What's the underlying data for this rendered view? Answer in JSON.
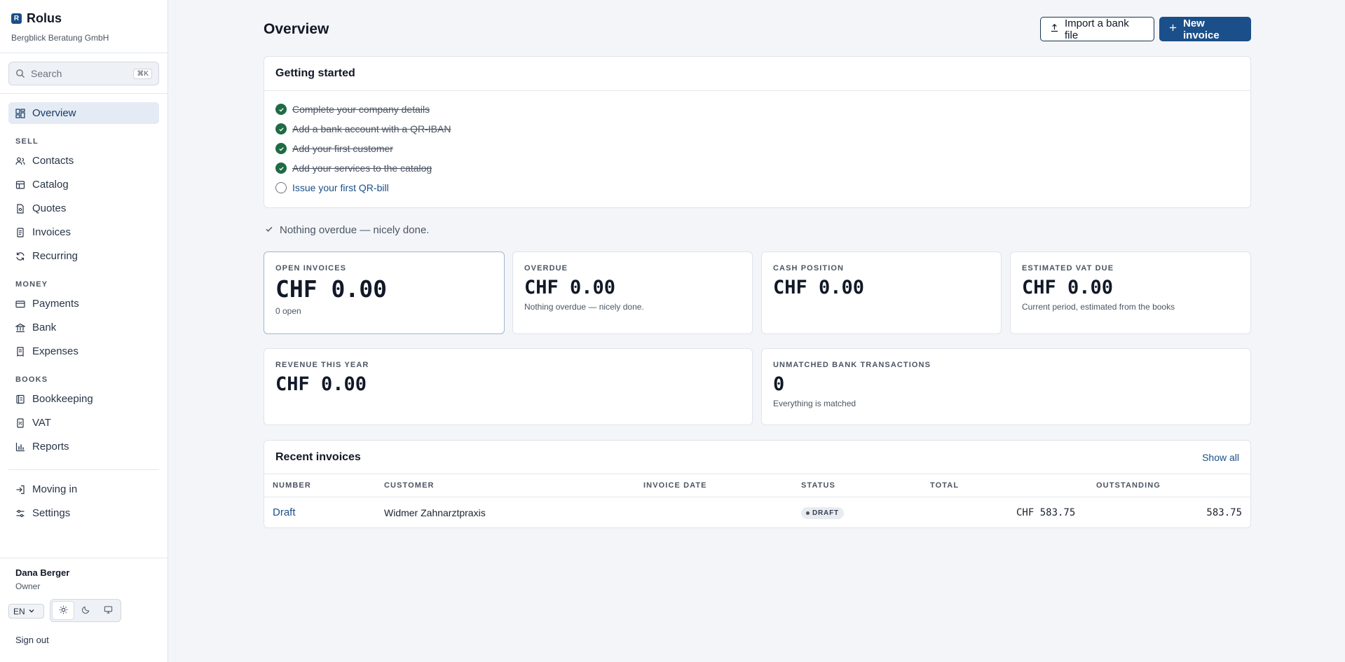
{
  "brand": {
    "logo_letter": "R",
    "name": "Rolus",
    "company": "Bergblick Beratung GmbH"
  },
  "search": {
    "placeholder": "Search",
    "shortcut": "⌘K"
  },
  "nav": {
    "overview": "Overview",
    "sections": {
      "sell": "SELL",
      "money": "MONEY",
      "books": "BOOKS"
    },
    "contacts": "Contacts",
    "catalog": "Catalog",
    "quotes": "Quotes",
    "invoices": "Invoices",
    "recurring": "Recurring",
    "payments": "Payments",
    "bank": "Bank",
    "expenses": "Expenses",
    "bookkeeping": "Bookkeeping",
    "vat": "VAT",
    "reports": "Reports",
    "moving_in": "Moving in",
    "settings": "Settings"
  },
  "user": {
    "name": "Dana Berger",
    "role": "Owner",
    "language": "EN",
    "theme": "light",
    "sign_out": "Sign out"
  },
  "header": {
    "title": "Overview",
    "import_label": "Import a bank file",
    "new_invoice_label": "New invoice"
  },
  "getting_started": {
    "title": "Getting started",
    "tasks": [
      {
        "label": "Complete your company details",
        "done": true
      },
      {
        "label": "Add a bank account with a QR-IBAN",
        "done": true
      },
      {
        "label": "Add your first customer",
        "done": true
      },
      {
        "label": "Add your services to the catalog",
        "done": true
      },
      {
        "label": "Issue your first QR-bill",
        "done": false
      }
    ]
  },
  "overdue_notice": "Nothing overdue — nicely done.",
  "stats": {
    "open_invoices": {
      "label": "OPEN INVOICES",
      "value": "CHF 0.00",
      "sub": "0 open"
    },
    "overdue": {
      "label": "OVERDUE",
      "value": "CHF 0.00",
      "sub": "Nothing overdue — nicely done."
    },
    "cash_position": {
      "label": "CASH POSITION",
      "value": "CHF 0.00"
    },
    "estimated_vat": {
      "label": "ESTIMATED VAT DUE",
      "value": "CHF 0.00",
      "sub": "Current period, estimated from the books"
    },
    "revenue": {
      "label": "REVENUE THIS YEAR",
      "value": "CHF 0.00"
    },
    "unmatched": {
      "label": "UNMATCHED BANK TRANSACTIONS",
      "value": "0",
      "sub": "Everything is matched"
    }
  },
  "recent_invoices": {
    "title": "Recent invoices",
    "show_all": "Show all",
    "columns": {
      "number": "NUMBER",
      "customer": "CUSTOMER",
      "invoice_date": "INVOICE DATE",
      "status": "STATUS",
      "total": "TOTAL",
      "outstanding": "OUTSTANDING"
    },
    "rows": [
      {
        "number": "Draft",
        "customer": "Widmer Zahnarztpraxis",
        "invoice_date": "",
        "status": "DRAFT",
        "total": "CHF 583.75",
        "outstanding": "583.75"
      }
    ]
  },
  "colors": {
    "brand": "#1b4f8a",
    "success": "#1f6b44",
    "background": "#f3f5f8"
  }
}
